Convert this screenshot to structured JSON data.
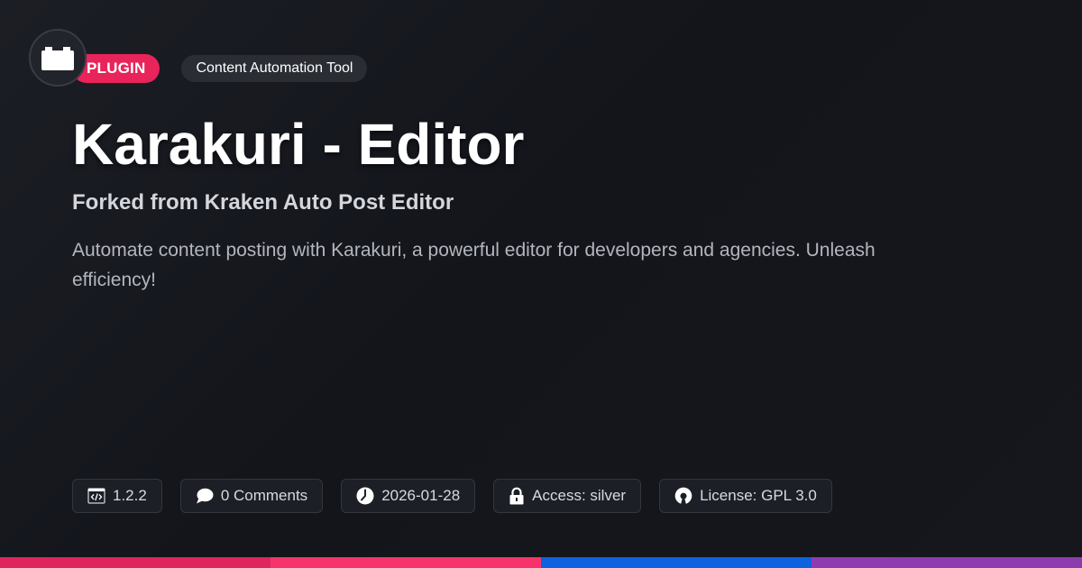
{
  "badges": {
    "type_label": "PLUGIN",
    "category_label": "Content Automation Tool"
  },
  "product": {
    "title": "Karakuri - Editor",
    "subtitle": "Forked from Kraken Auto Post Editor",
    "description": "Automate content posting with Karakuri, a powerful editor for developers and agencies. Unleash efficiency!"
  },
  "meta": {
    "version": "1.2.2",
    "comments": "0 Comments",
    "date": "2026-01-28",
    "access": "Access: silver",
    "license": "License: GPL 3.0"
  },
  "icons": {
    "logo": "plugin-block-icon",
    "version": "code-window-icon",
    "comments": "speech-bubble-icon",
    "date": "clock-icon",
    "access": "padlock-icon",
    "license": "open-source-icon"
  },
  "colors": {
    "background": "#16181e",
    "plugin_badge": "#e8245a",
    "category_badge": "#2b2d35",
    "bar_segments": [
      "#e0245e",
      "#f7336b",
      "#0d62e0",
      "#8e3bb0"
    ]
  }
}
